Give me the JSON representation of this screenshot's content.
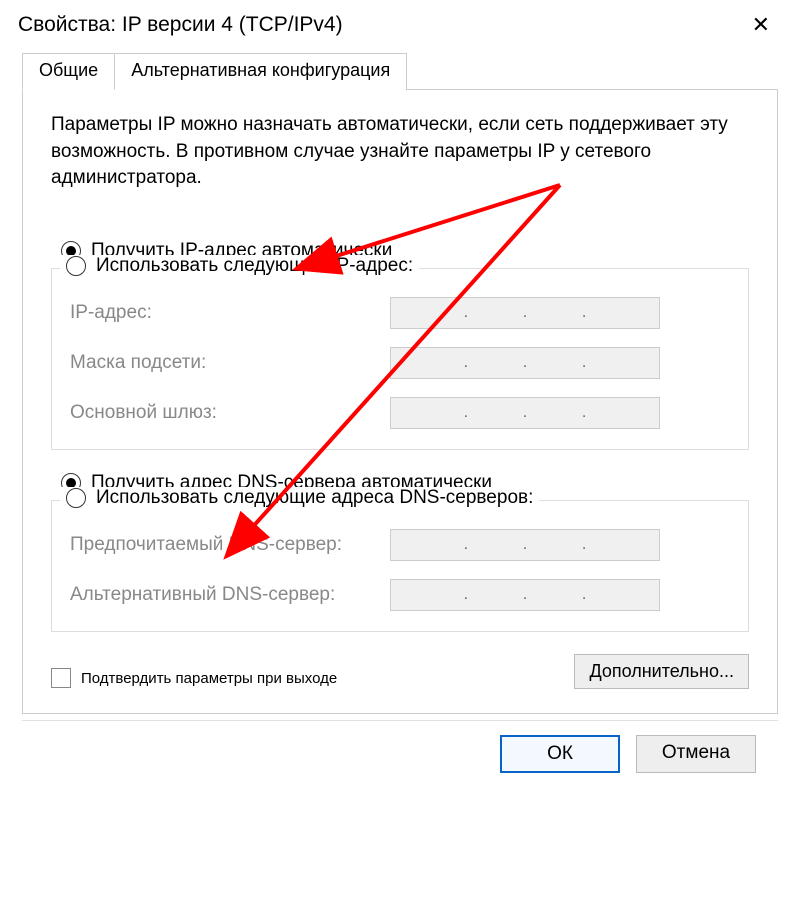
{
  "title": "Свойства: IP версии 4 (TCP/IPv4)",
  "tabs": [
    {
      "label": "Общие"
    },
    {
      "label": "Альтернативная конфигурация"
    }
  ],
  "intro": "Параметры IP можно назначать автоматически, если сеть поддерживает эту возможность. В противном случае узнайте параметры IP у сетевого администратора.",
  "ip_section": {
    "auto_label": "Получить IP-адрес автоматически",
    "manual_label": "Использовать следующий IP-адрес:",
    "fields": {
      "ip": "IP-адрес:",
      "mask": "Маска подсети:",
      "gateway": "Основной шлюз:"
    }
  },
  "dns_section": {
    "auto_label": "Получить адрес DNS-сервера автоматически",
    "manual_label": "Использовать следующие адреса DNS-серверов:",
    "fields": {
      "preferred": "Предпочитаемый DNS-сервер:",
      "alternate": "Альтернативный DNS-сервер:"
    }
  },
  "validate_label": "Подтвердить параметры при выходе",
  "advanced_label": "Дополнительно...",
  "ok_label": "ОК",
  "cancel_label": "Отмена",
  "annotation": {
    "color": "#ff0000"
  }
}
